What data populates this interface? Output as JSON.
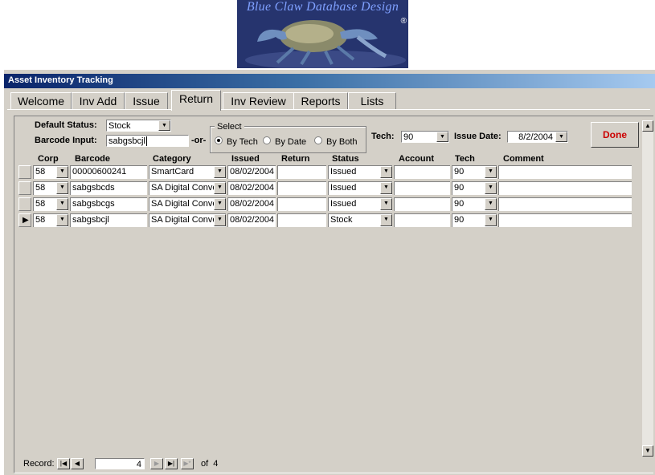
{
  "logo": {
    "text": "Blue Claw Database Design",
    "mark": "®"
  },
  "window": {
    "title": "Asset Inventory Tracking"
  },
  "tabs": [
    {
      "label": "Welcome",
      "active": false
    },
    {
      "label": "Inv Add",
      "active": false
    },
    {
      "label": "Issue",
      "active": false
    },
    {
      "label": "Return",
      "active": true
    },
    {
      "label": "Inv Review",
      "active": false
    },
    {
      "label": "Reports",
      "active": false
    },
    {
      "label": "Lists",
      "active": false
    }
  ],
  "form": {
    "default_status_label": "Default Status:",
    "default_status_value": "Stock",
    "barcode_label": "Barcode Input:",
    "barcode_value": "sabgsbcjl",
    "or_label": "-or-",
    "select_legend": "Select",
    "radios": [
      {
        "label": "By Tech",
        "selected": true
      },
      {
        "label": "By Date",
        "selected": false
      },
      {
        "label": "By Both",
        "selected": false
      }
    ],
    "tech_label": "Tech:",
    "tech_value": "90",
    "issue_date_label": "Issue Date:",
    "issue_date_value": "8/2/2004",
    "done_label": "Done"
  },
  "grid": {
    "columns": [
      "Corp",
      "Barcode",
      "Category",
      "Issued",
      "Return",
      "Status",
      "Account",
      "Tech",
      "Comment"
    ],
    "rows": [
      {
        "corp": "58",
        "barcode": "00000600241",
        "category": "SmartCard",
        "issued": "08/02/2004",
        "return": "",
        "status": "Issued",
        "account": "",
        "tech": "90",
        "comment": "",
        "current": false
      },
      {
        "corp": "58",
        "barcode": "sabgsbcds",
        "category": "SA Digital Conve",
        "issued": "08/02/2004",
        "return": "",
        "status": "Issued",
        "account": "",
        "tech": "90",
        "comment": "",
        "current": false
      },
      {
        "corp": "58",
        "barcode": "sabgsbcgs",
        "category": "SA Digital Conve",
        "issued": "08/02/2004",
        "return": "",
        "status": "Issued",
        "account": "",
        "tech": "90",
        "comment": "",
        "current": false
      },
      {
        "corp": "58",
        "barcode": "sabgsbcjl",
        "category": "SA Digital Conve",
        "issued": "08/02/2004",
        "return": "",
        "status": "Stock",
        "account": "",
        "tech": "90",
        "comment": "",
        "current": true
      }
    ]
  },
  "nav": {
    "record_label": "Record:",
    "current": "4",
    "of_label": "of  4"
  },
  "colors": {
    "titlebar_start": "#0a246a",
    "titlebar_end": "#a6caf0",
    "done_text": "#cc0000",
    "face": "#d4d0c8"
  }
}
